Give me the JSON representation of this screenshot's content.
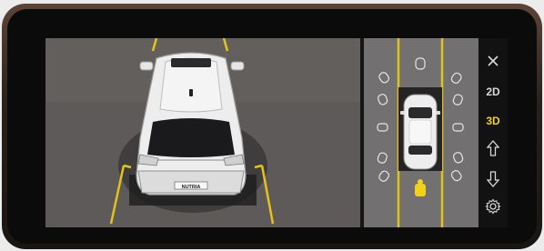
{
  "screen": {
    "mode_labels": {
      "mode_2d": "2D",
      "mode_3d": "3D"
    },
    "active_mode": "3D",
    "plate_text": "NUTRIA"
  },
  "controls": [
    {
      "name": "close-icon",
      "icon": "close"
    },
    {
      "name": "view-2d-button",
      "label": "2D"
    },
    {
      "name": "view-3d-button",
      "label": "3D"
    },
    {
      "name": "front-camera-icon",
      "icon": "arrow-up"
    },
    {
      "name": "rear-camera-icon",
      "icon": "arrow-down"
    },
    {
      "name": "settings-icon",
      "icon": "gear"
    }
  ],
  "colors": {
    "guide_line": "#e3c21c",
    "active": "#f0d21a",
    "icon_default": "#d8d8d8"
  }
}
